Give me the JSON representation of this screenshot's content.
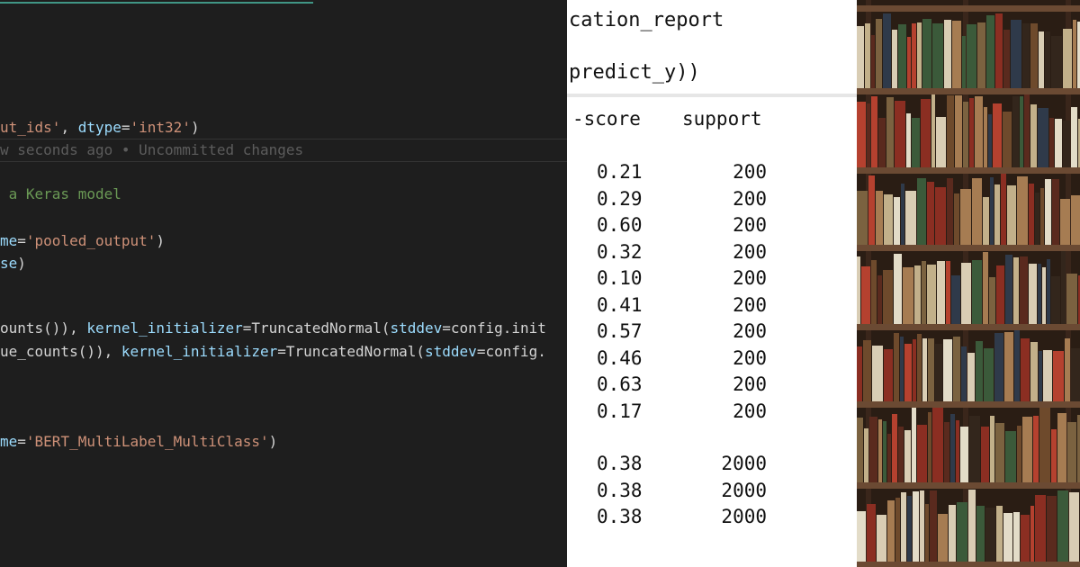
{
  "editor": {
    "lines": [
      {
        "segments": [
          {
            "text": "ut_ids'",
            "cls": "str"
          },
          {
            "text": ", ",
            "cls": "def"
          },
          {
            "text": "dtype",
            "cls": "param"
          },
          {
            "text": "=",
            "cls": "def"
          },
          {
            "text": "'int32'",
            "cls": "str"
          },
          {
            "text": ")",
            "cls": "def"
          }
        ]
      },
      {
        "segments": [
          {
            "text": "w seconds ago • Uncommitted changes",
            "cls": "blame"
          }
        ]
      },
      {
        "segments": [
          {
            "text": " a Keras model",
            "cls": "com"
          }
        ]
      },
      {
        "segments": [
          {
            "text": "me",
            "cls": "param"
          },
          {
            "text": "=",
            "cls": "def"
          },
          {
            "text": "'pooled_output'",
            "cls": "str"
          },
          {
            "text": ")",
            "cls": "def"
          }
        ]
      },
      {
        "segments": [
          {
            "text": "se",
            "cls": "param"
          },
          {
            "text": ")",
            "cls": "def"
          }
        ]
      },
      {
        "segments": [
          {
            "text": "ounts()), ",
            "cls": "def"
          },
          {
            "text": "kernel_initializer",
            "cls": "param"
          },
          {
            "text": "=TruncatedNormal(",
            "cls": "def"
          },
          {
            "text": "stddev",
            "cls": "param"
          },
          {
            "text": "=config.init",
            "cls": "def"
          }
        ]
      },
      {
        "segments": [
          {
            "text": "ue_counts()), ",
            "cls": "def"
          },
          {
            "text": "kernel_initializer",
            "cls": "param"
          },
          {
            "text": "=TruncatedNormal(",
            "cls": "def"
          },
          {
            "text": "stddev",
            "cls": "param"
          },
          {
            "text": "=config.",
            "cls": "def"
          }
        ]
      },
      {
        "segments": [
          {
            "text": "me",
            "cls": "param"
          },
          {
            "text": "=",
            "cls": "def"
          },
          {
            "text": "'BERT_MultiLabel_MultiClass'",
            "cls": "str"
          },
          {
            "text": ")",
            "cls": "def"
          }
        ]
      }
    ]
  },
  "report": {
    "code_line_1": "cation_report",
    "code_line_2": "predict_y))",
    "header_score": "-score",
    "header_support": "support",
    "rows": [
      {
        "score": "0.21",
        "support": "200"
      },
      {
        "score": "0.29",
        "support": "200"
      },
      {
        "score": "0.60",
        "support": "200"
      },
      {
        "score": "0.32",
        "support": "200"
      },
      {
        "score": "0.10",
        "support": "200"
      },
      {
        "score": "0.41",
        "support": "200"
      },
      {
        "score": "0.57",
        "support": "200"
      },
      {
        "score": "0.46",
        "support": "200"
      },
      {
        "score": "0.63",
        "support": "200"
      },
      {
        "score": "0.17",
        "support": "200"
      }
    ],
    "summary_rows": [
      {
        "score": "0.38",
        "support": "2000"
      },
      {
        "score": "0.38",
        "support": "2000"
      },
      {
        "score": "0.38",
        "support": "2000"
      }
    ]
  },
  "photo": {
    "book_colors": [
      "#8b2e22",
      "#d9cdb4",
      "#3b5a3a",
      "#6e4a2c",
      "#a67c52",
      "#2f3a4a",
      "#c2b08a",
      "#5a2a1e",
      "#e3dcc8",
      "#7b6240",
      "#33261c",
      "#b5412f"
    ]
  }
}
